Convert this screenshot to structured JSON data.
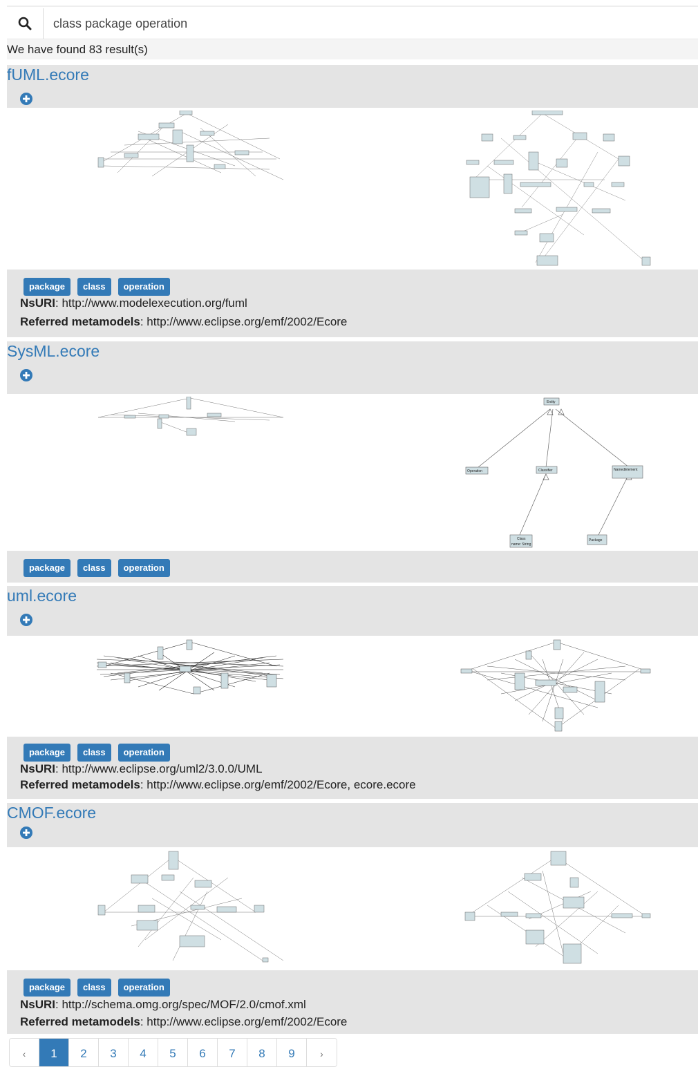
{
  "search": {
    "value": "class package operation",
    "placeholder": ""
  },
  "result_count": "We have found 83 result(s)",
  "labels": {
    "nsuri": "NsURI",
    "referred": "Referred metamodels"
  },
  "results": [
    {
      "title": "fUML.ecore",
      "tags": [
        "package",
        "class",
        "operation"
      ],
      "nsuri": "http://www.modelexecution.org/fuml",
      "referred": "http://www.eclipse.org/emf/2002/Ecore"
    },
    {
      "title": "SysML.ecore",
      "tags": [
        "package",
        "class",
        "operation"
      ],
      "nsuri": "",
      "referred": ""
    },
    {
      "title": "uml.ecore",
      "tags": [
        "package",
        "class",
        "operation"
      ],
      "nsuri": "http://www.eclipse.org/uml2/3.0.0/UML",
      "referred": "http://www.eclipse.org/emf/2002/Ecore, ecore.ecore"
    },
    {
      "title": "CMOF.ecore",
      "tags": [
        "package",
        "class",
        "operation"
      ],
      "nsuri": "http://schema.omg.org/spec/MOF/2.0/cmof.xml",
      "referred": "http://www.eclipse.org/emf/2002/Ecore"
    }
  ],
  "sysml_diagram": {
    "nodes": [
      "Entity",
      "Operation",
      "Classifier",
      "NamedElement",
      "Class",
      "Package"
    ],
    "class_attr": "name: String"
  },
  "pagination": {
    "prev": "‹",
    "pages": [
      "1",
      "2",
      "3",
      "4",
      "5",
      "6",
      "7",
      "8",
      "9"
    ],
    "next": "›",
    "active": "1"
  },
  "colors": {
    "accent": "#337ab7",
    "band": "#e4e4e4"
  },
  "icons": {
    "search": "search-icon",
    "expand": "plus-circle-icon"
  }
}
